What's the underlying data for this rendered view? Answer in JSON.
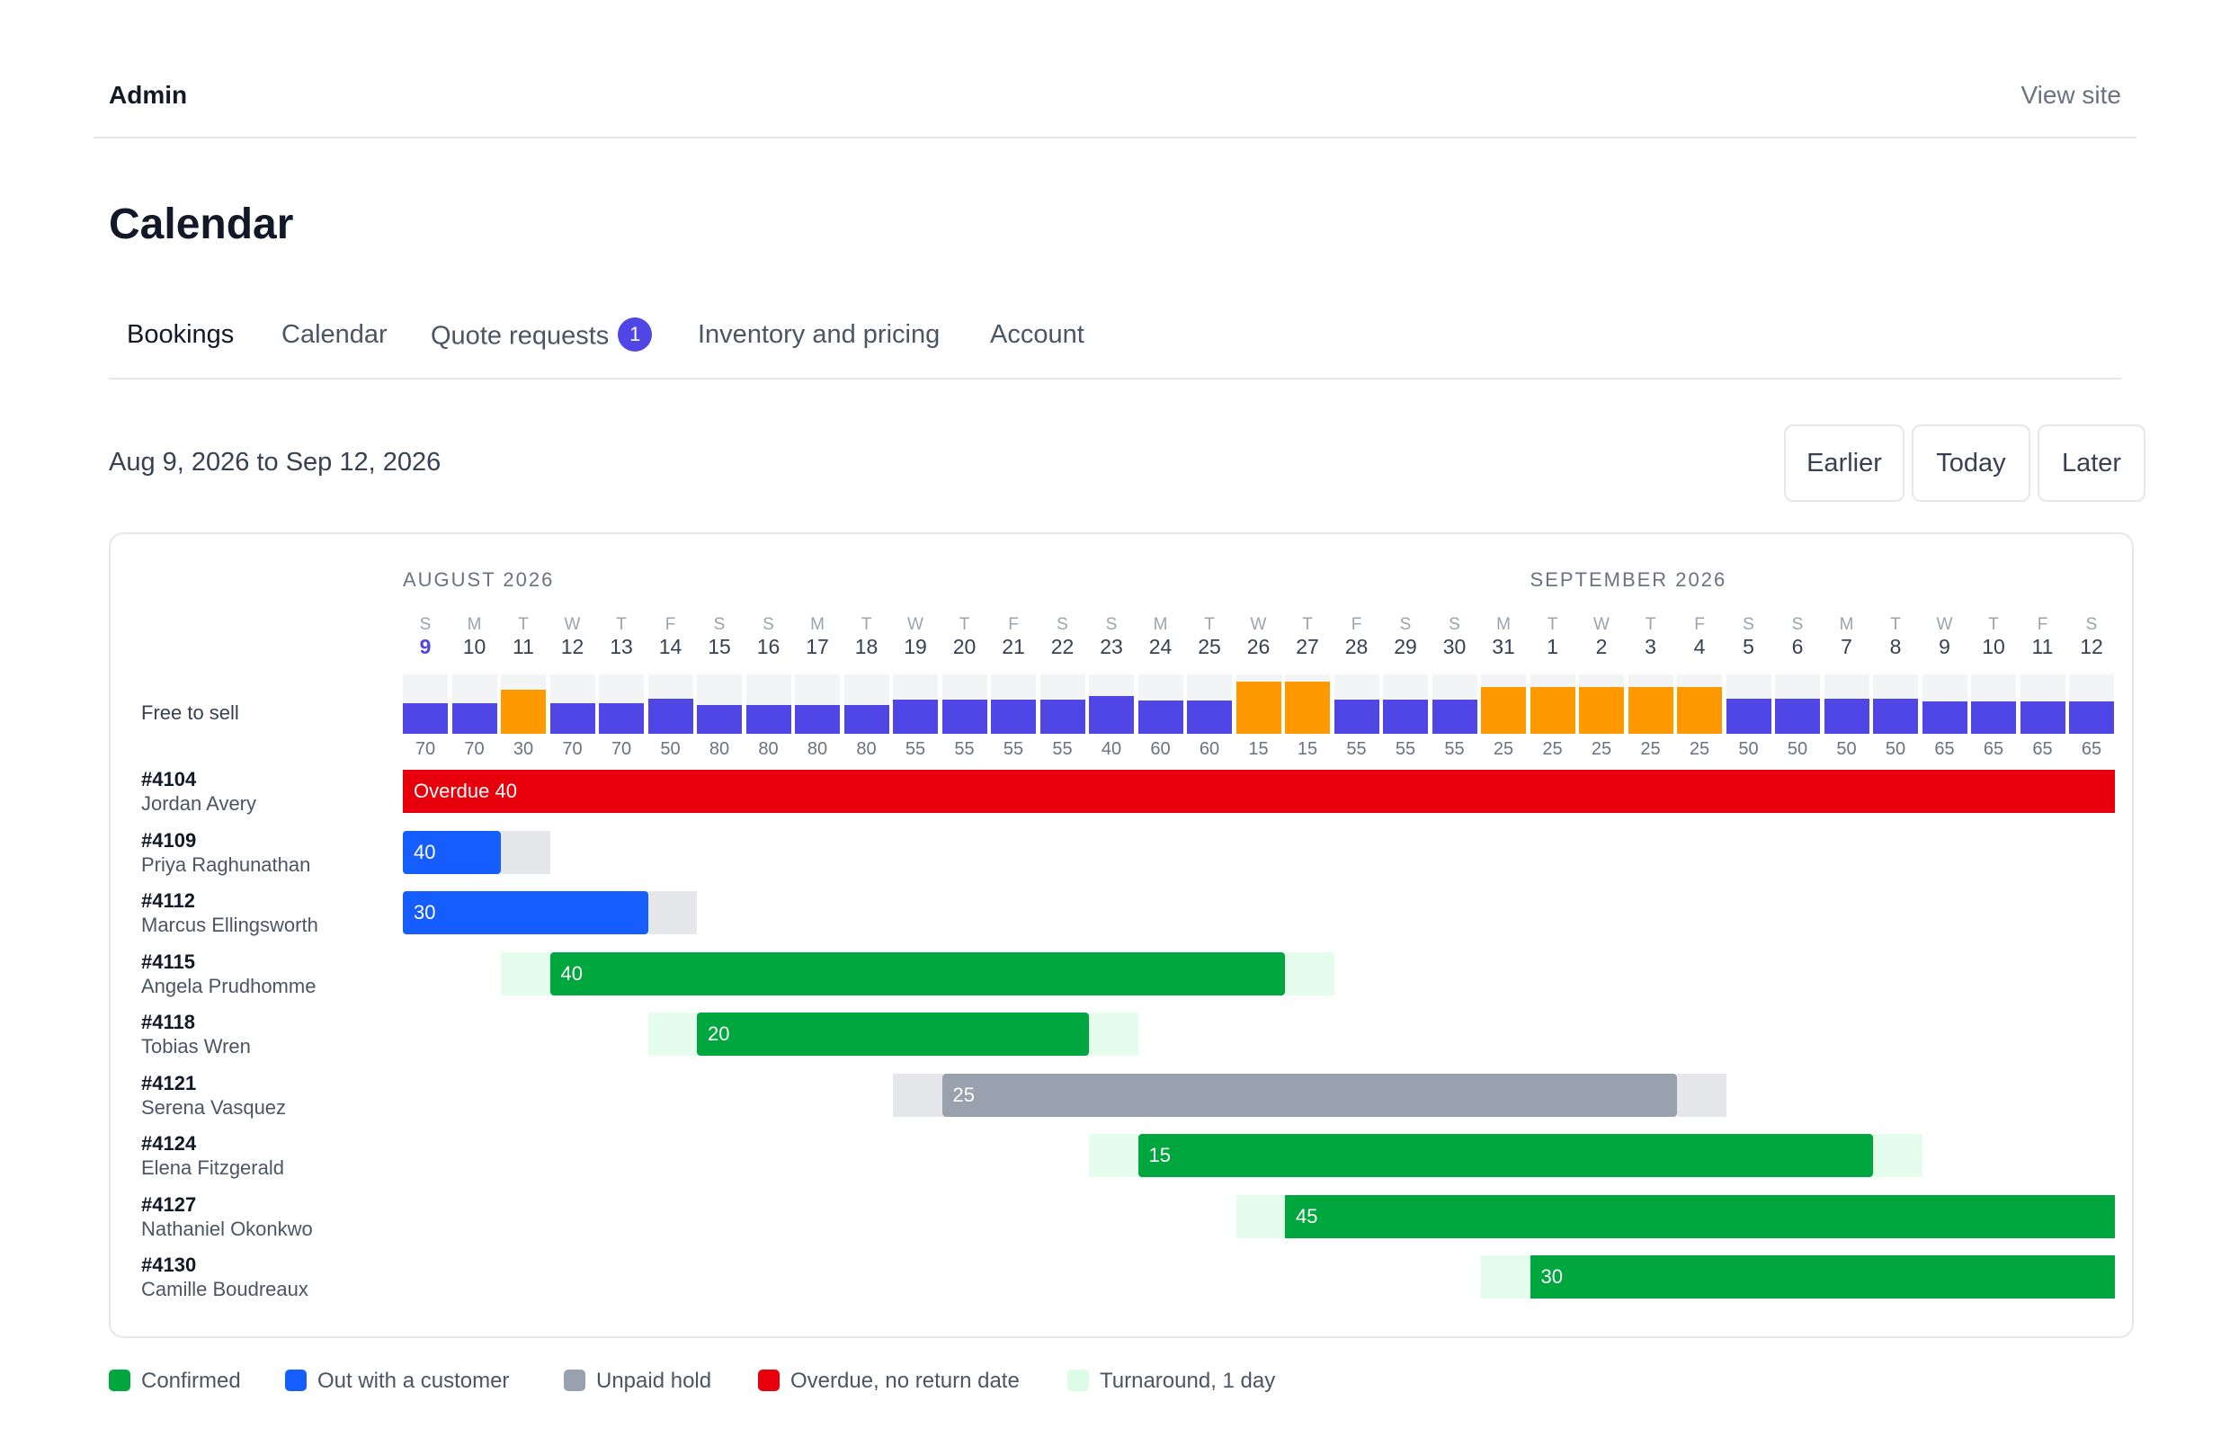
{
  "header": {
    "brand": "Admin",
    "view_site": "View site"
  },
  "page_title": "Calendar",
  "tabs": [
    {
      "label": "Bookings",
      "active": true
    },
    {
      "label": "Calendar",
      "active": false
    },
    {
      "label": "Quote requests",
      "badge": "1",
      "active": false
    },
    {
      "label": "Inventory and pricing",
      "active": false
    },
    {
      "label": "Account",
      "active": false
    }
  ],
  "date_range": "Aug 9, 2026 to Sep 12, 2026",
  "nav": {
    "earlier": "Earlier",
    "today": "Today",
    "later": "Later"
  },
  "calendar": {
    "months": [
      {
        "label": "AUGUST 2026",
        "start_index": 0
      },
      {
        "label": "SEPTEMBER 2026",
        "start_index": 23
      }
    ],
    "days": [
      {
        "dow": "S",
        "num": "9"
      },
      {
        "dow": "M",
        "num": "10"
      },
      {
        "dow": "T",
        "num": "11"
      },
      {
        "dow": "W",
        "num": "12"
      },
      {
        "dow": "T",
        "num": "13"
      },
      {
        "dow": "F",
        "num": "14"
      },
      {
        "dow": "S",
        "num": "15"
      },
      {
        "dow": "S",
        "num": "16"
      },
      {
        "dow": "M",
        "num": "17"
      },
      {
        "dow": "T",
        "num": "18"
      },
      {
        "dow": "W",
        "num": "19"
      },
      {
        "dow": "T",
        "num": "20"
      },
      {
        "dow": "F",
        "num": "21"
      },
      {
        "dow": "S",
        "num": "22"
      },
      {
        "dow": "S",
        "num": "23"
      },
      {
        "dow": "M",
        "num": "24"
      },
      {
        "dow": "T",
        "num": "25"
      },
      {
        "dow": "W",
        "num": "26"
      },
      {
        "dow": "T",
        "num": "27"
      },
      {
        "dow": "F",
        "num": "28"
      },
      {
        "dow": "S",
        "num": "29"
      },
      {
        "dow": "S",
        "num": "30"
      },
      {
        "dow": "M",
        "num": "31"
      },
      {
        "dow": "T",
        "num": "1"
      },
      {
        "dow": "W",
        "num": "2"
      },
      {
        "dow": "T",
        "num": "3"
      },
      {
        "dow": "F",
        "num": "4"
      },
      {
        "dow": "S",
        "num": "5"
      },
      {
        "dow": "S",
        "num": "6"
      },
      {
        "dow": "M",
        "num": "7"
      },
      {
        "dow": "T",
        "num": "8"
      },
      {
        "dow": "W",
        "num": "9"
      },
      {
        "dow": "T",
        "num": "10"
      },
      {
        "dow": "F",
        "num": "11"
      },
      {
        "dow": "S",
        "num": "12"
      }
    ],
    "today_index": 0,
    "free_to_sell_label": "Free to sell",
    "free_to_sell": [
      70,
      70,
      30,
      70,
      70,
      50,
      80,
      80,
      80,
      80,
      55,
      55,
      55,
      55,
      40,
      60,
      60,
      15,
      15,
      55,
      55,
      55,
      25,
      25,
      25,
      25,
      25,
      50,
      50,
      50,
      50,
      65,
      65,
      65,
      65
    ],
    "low_threshold": 30,
    "bookings": [
      {
        "id": "#4104",
        "name": "Jordan Avery",
        "label": "Overdue 40",
        "status": "overdue",
        "start": 0,
        "end": 35,
        "turn_before": 0,
        "turn_after": 0
      },
      {
        "id": "#4109",
        "name": "Priya Raghunathan",
        "label": "40",
        "status": "out",
        "start": 0,
        "end": 2,
        "turn_before": 0,
        "turn_after": 1
      },
      {
        "id": "#4112",
        "name": "Marcus Ellingsworth",
        "label": "30",
        "status": "out",
        "start": 0,
        "end": 5,
        "turn_before": 0,
        "turn_after": 1
      },
      {
        "id": "#4115",
        "name": "Angela Prudhomme",
        "label": "40",
        "status": "confirmed",
        "start": 3,
        "end": 18,
        "turn_before": 1,
        "turn_after": 1
      },
      {
        "id": "#4118",
        "name": "Tobias Wren",
        "label": "20",
        "status": "confirmed",
        "start": 6,
        "end": 14,
        "turn_before": 1,
        "turn_after": 1
      },
      {
        "id": "#4121",
        "name": "Serena Vasquez",
        "label": "25",
        "status": "hold",
        "start": 11,
        "end": 26,
        "turn_before": 1,
        "turn_after": 1
      },
      {
        "id": "#4124",
        "name": "Elena Fitzgerald",
        "label": "15",
        "status": "confirmed",
        "start": 15,
        "end": 30,
        "turn_before": 1,
        "turn_after": 1
      },
      {
        "id": "#4127",
        "name": "Nathaniel Okonkwo",
        "label": "45",
        "status": "confirmed",
        "start": 18,
        "end": 35,
        "turn_before": 1,
        "turn_after": 0
      },
      {
        "id": "#4130",
        "name": "Camille Boudreaux",
        "label": "30",
        "status": "confirmed",
        "start": 23,
        "end": 35,
        "turn_before": 1,
        "turn_after": 0
      }
    ]
  },
  "colors": {
    "confirmed": "#00a63e",
    "out": "#155dfc",
    "hold": "#99a1af",
    "overdue": "#e7000b",
    "turnaround": "#dcfce7",
    "turnaround_grey": "#e5e7eb",
    "inventory": "#4f46e5",
    "inventory_low": "#fe9a00",
    "accent": "#4f46e5"
  },
  "legend": [
    {
      "key": "confirmed",
      "label": "Confirmed"
    },
    {
      "key": "out",
      "label": "Out with a customer"
    },
    {
      "key": "hold",
      "label": "Unpaid hold"
    },
    {
      "key": "overdue",
      "label": "Overdue, no return date"
    },
    {
      "key": "turnaround",
      "label": "Turnaround, 1 day"
    }
  ]
}
